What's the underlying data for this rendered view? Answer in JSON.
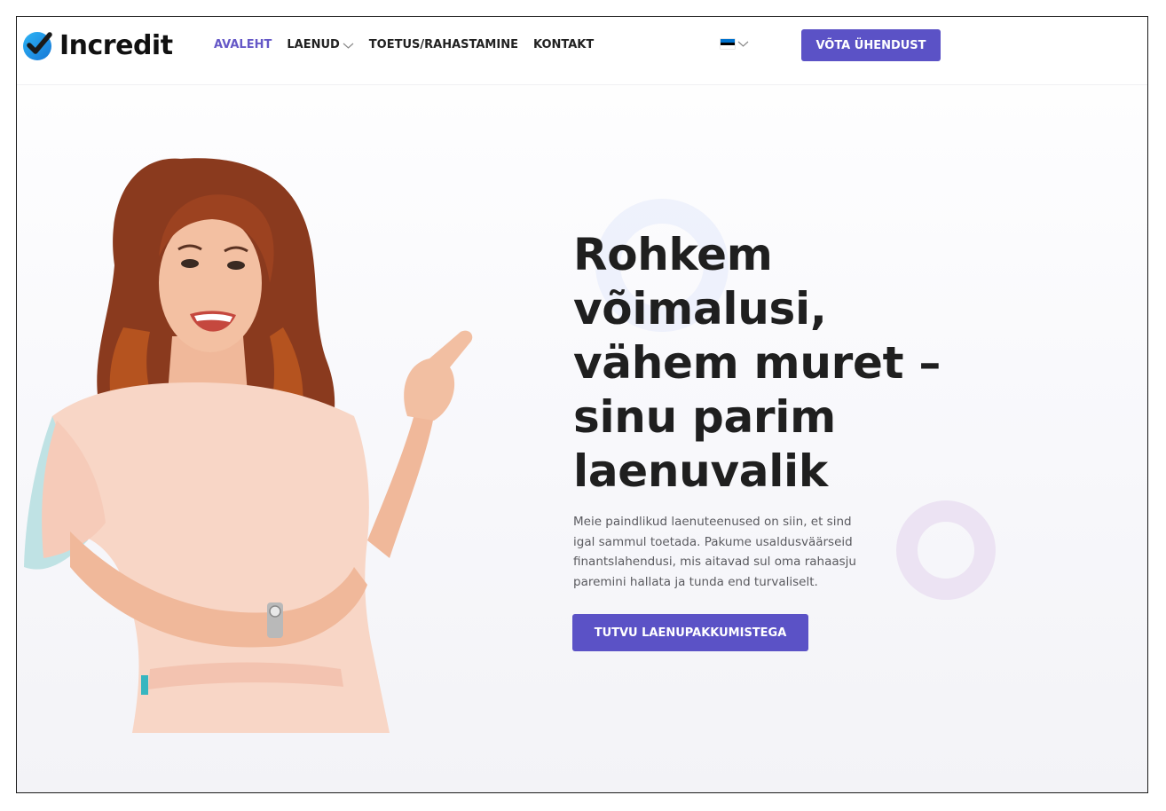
{
  "header": {
    "logo_text": "Incredit",
    "nav": [
      {
        "label": "AVALEHT",
        "active": true
      },
      {
        "label": "LAENUD",
        "has_dropdown": true
      },
      {
        "label": "TOETUS/RAHASTAMINE"
      },
      {
        "label": "KONTAKT"
      }
    ],
    "language": {
      "flag": "estonia-flag",
      "flag_colors": [
        "#0072ce",
        "#000000",
        "#ffffff"
      ]
    },
    "cta_label": "VÕTA ÜHENDUST"
  },
  "hero": {
    "headline_lines": [
      "Rohkem",
      "võimalusi,",
      "vähem muret –",
      "sinu parim",
      "laenuvalik"
    ],
    "subtext_lines": [
      "Meie paindlikud laenuteenused on siin, et sind",
      "igal sammul toetada. Pakume usaldusväärseid",
      "finantslahendusi, mis aitavad sul oma rahaasju",
      "paremini hallata ja tunda end turvaliselt."
    ],
    "cta_label": "TUTVU LAENUPAKKUMISTEGA"
  },
  "colors": {
    "accent": "#5b52c6",
    "nav_active": "#6558c7",
    "logo_check": "#1a9be8",
    "headline": "#1f1f1f",
    "body_text": "#5a5a5f"
  }
}
